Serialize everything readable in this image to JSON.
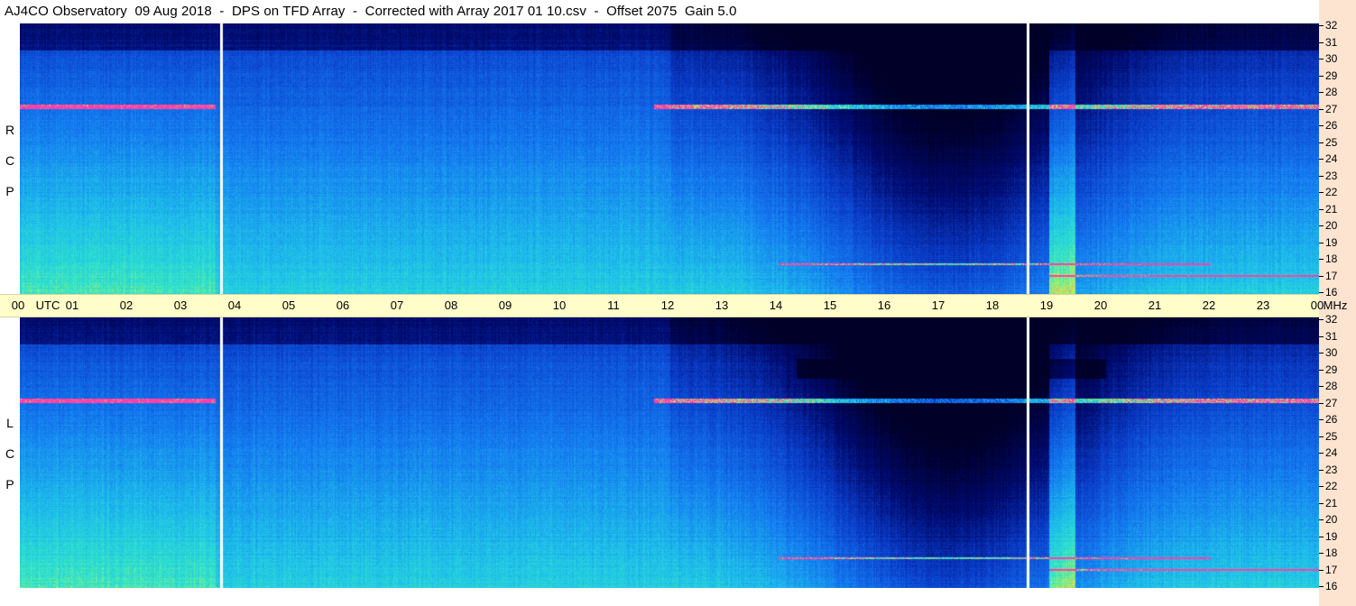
{
  "title": "AJ4CO Observatory  09 Aug 2018  -  DPS on TFD Array  -  Corrected with Array 2017 01 10.csv  -  Offset 2075  Gain 5.0",
  "time_labels": [
    {
      "text": "00",
      "hour": 0
    },
    {
      "text": "UTC",
      "hour": 0.55
    },
    {
      "text": "01",
      "hour": 1
    },
    {
      "text": "02",
      "hour": 2
    },
    {
      "text": "03",
      "hour": 3
    },
    {
      "text": "04",
      "hour": 4
    },
    {
      "text": "05",
      "hour": 5
    },
    {
      "text": "06",
      "hour": 6
    },
    {
      "text": "07",
      "hour": 7
    },
    {
      "text": "08",
      "hour": 8
    },
    {
      "text": "09",
      "hour": 9
    },
    {
      "text": "10",
      "hour": 10
    },
    {
      "text": "11",
      "hour": 11
    },
    {
      "text": "12",
      "hour": 12
    },
    {
      "text": "13",
      "hour": 13
    },
    {
      "text": "14",
      "hour": 14
    },
    {
      "text": "15",
      "hour": 15
    },
    {
      "text": "16",
      "hour": 16
    },
    {
      "text": "17",
      "hour": 17
    },
    {
      "text": "18",
      "hour": 18
    },
    {
      "text": "19",
      "hour": 19
    },
    {
      "text": "20",
      "hour": 20
    },
    {
      "text": "21",
      "hour": 21
    },
    {
      "text": "22",
      "hour": 22
    },
    {
      "text": "23",
      "hour": 23
    },
    {
      "text": "00",
      "hour": 24
    },
    {
      "text": "MHz",
      "hour": 24.5
    }
  ],
  "freq_labels": [
    "32",
    "31",
    "30",
    "29",
    "28",
    "27",
    "26",
    "25",
    "24",
    "23",
    "22",
    "21",
    "20",
    "19",
    "18",
    "17",
    "16"
  ],
  "panels": [
    {
      "id": "rcp",
      "label": [
        "R",
        "C",
        "P"
      ]
    },
    {
      "id": "lcp",
      "label": [
        "L",
        "C",
        "P"
      ]
    }
  ],
  "chart_data": {
    "type": "heatmap",
    "title": "AJ4CO Observatory  09 Aug 2018  -  DPS on TFD Array  -  Corrected with Array 2017 01 10.csv  -  Offset 2075  Gain 5.0",
    "x_axis": {
      "unit": "UTC",
      "range": [
        0,
        24
      ]
    },
    "y_axis": {
      "unit": "MHz",
      "range": [
        16,
        32
      ]
    },
    "panels": [
      "RCP",
      "LCP"
    ],
    "data_gaps_utc": [
      3.7,
      18.6
    ],
    "interference_band_utc": [
      19.0,
      19.5
    ],
    "persistent_interference_mhz": [
      27.1,
      17.8,
      17.1
    ],
    "colors": {
      "low": "#00005a",
      "mid": "#0a6cff",
      "high": "#2ef0d8",
      "peak": "#ff2ea0"
    }
  }
}
